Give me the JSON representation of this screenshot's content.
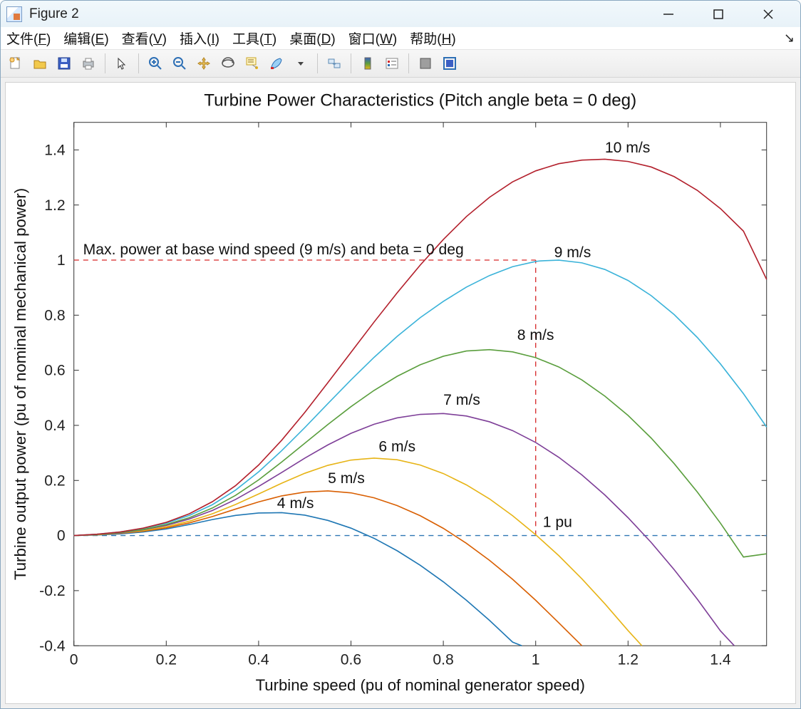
{
  "window": {
    "title": "Figure 2"
  },
  "menu": {
    "file": {
      "label": "文件",
      "key": "F"
    },
    "edit": {
      "label": "编辑",
      "key": "E"
    },
    "view": {
      "label": "查看",
      "key": "V"
    },
    "insert": {
      "label": "插入",
      "key": "I"
    },
    "tools": {
      "label": "工具",
      "key": "T"
    },
    "desktop": {
      "label": "桌面",
      "key": "D"
    },
    "window": {
      "label": "窗口",
      "key": "W"
    },
    "help": {
      "label": "帮助",
      "key": "H"
    }
  },
  "toolbar_icons": [
    "new-figure-icon",
    "open-icon",
    "save-icon",
    "print-icon",
    "|",
    "pointer-icon",
    "|",
    "zoom-in-icon",
    "zoom-out-icon",
    "pan-icon",
    "rotate3d-icon",
    "data-cursor-icon",
    "brush-icon",
    "dropdown-icon",
    "|",
    "link-plot-icon",
    "|",
    "colorbar-icon",
    "legend-icon",
    "|",
    "hide-plot-icon",
    "show-plot-icon"
  ],
  "chart_data": {
    "type": "line",
    "title": "Turbine Power Characteristics (Pitch angle beta = 0 deg)",
    "xlabel": "Turbine speed (pu of nominal generator speed)",
    "ylabel": "Turbine output power (pu of nominal mechanical power)",
    "xlim": [
      0,
      1.5
    ],
    "ylim": [
      -0.4,
      1.5
    ],
    "xticks": [
      0,
      0.2,
      0.4,
      0.6,
      0.8,
      1,
      1.2,
      1.4
    ],
    "yticks": [
      -0.4,
      -0.2,
      0,
      0.2,
      0.4,
      0.6,
      0.8,
      1,
      1.2,
      1.4
    ],
    "annotations": {
      "max_power": "Max. power at base wind speed (9 m/s) and beta = 0 deg",
      "one_pu": "1 pu"
    },
    "ref_lines": {
      "h_zero": {
        "y": 0,
        "color": "#2f77b4",
        "dash": true
      },
      "h_one": {
        "y": 1,
        "x_to": 1.0,
        "color": "#d62728",
        "dash": true
      },
      "v_one": {
        "x": 1.0,
        "y_from": 0,
        "y_to": 1.0,
        "color": "#d62728",
        "dash": true
      }
    },
    "series": [
      {
        "name": "4 m/s",
        "color": "#1f77b4",
        "label_at": [
          0.44,
          0.1
        ],
        "points": [
          [
            0.0,
            0.0
          ],
          [
            0.05,
            0.002
          ],
          [
            0.1,
            0.006
          ],
          [
            0.15,
            0.013
          ],
          [
            0.2,
            0.024
          ],
          [
            0.25,
            0.04
          ],
          [
            0.3,
            0.058
          ],
          [
            0.35,
            0.073
          ],
          [
            0.4,
            0.082
          ],
          [
            0.45,
            0.083
          ],
          [
            0.5,
            0.074
          ],
          [
            0.55,
            0.055
          ],
          [
            0.6,
            0.027
          ],
          [
            0.65,
            -0.01
          ],
          [
            0.7,
            -0.055
          ],
          [
            0.75,
            -0.108
          ],
          [
            0.8,
            -0.168
          ],
          [
            0.85,
            -0.235
          ],
          [
            0.9,
            -0.308
          ],
          [
            0.95,
            -0.387
          ],
          [
            0.97,
            -0.4
          ]
        ]
      },
      {
        "name": "5 m/s",
        "color": "#d95f02",
        "label_at": [
          0.55,
          0.19
        ],
        "points": [
          [
            0.0,
            0.0
          ],
          [
            0.05,
            0.003
          ],
          [
            0.1,
            0.008
          ],
          [
            0.15,
            0.016
          ],
          [
            0.2,
            0.028
          ],
          [
            0.25,
            0.046
          ],
          [
            0.3,
            0.069
          ],
          [
            0.35,
            0.096
          ],
          [
            0.4,
            0.122
          ],
          [
            0.45,
            0.144
          ],
          [
            0.5,
            0.158
          ],
          [
            0.55,
            0.162
          ],
          [
            0.6,
            0.155
          ],
          [
            0.65,
            0.137
          ],
          [
            0.7,
            0.109
          ],
          [
            0.75,
            0.072
          ],
          [
            0.8,
            0.026
          ],
          [
            0.85,
            -0.028
          ],
          [
            0.9,
            -0.09
          ],
          [
            0.95,
            -0.159
          ],
          [
            1.0,
            -0.235
          ],
          [
            1.05,
            -0.317
          ],
          [
            1.1,
            -0.4
          ]
        ]
      },
      {
        "name": "6 m/s",
        "color": "#e7b416",
        "label_at": [
          0.66,
          0.305
        ],
        "points": [
          [
            0.0,
            0.0
          ],
          [
            0.05,
            0.003
          ],
          [
            0.1,
            0.009
          ],
          [
            0.15,
            0.018
          ],
          [
            0.2,
            0.032
          ],
          [
            0.25,
            0.052
          ],
          [
            0.3,
            0.079
          ],
          [
            0.35,
            0.113
          ],
          [
            0.4,
            0.151
          ],
          [
            0.45,
            0.19
          ],
          [
            0.5,
            0.226
          ],
          [
            0.55,
            0.255
          ],
          [
            0.6,
            0.274
          ],
          [
            0.65,
            0.281
          ],
          [
            0.7,
            0.275
          ],
          [
            0.75,
            0.256
          ],
          [
            0.8,
            0.225
          ],
          [
            0.85,
            0.184
          ],
          [
            0.9,
            0.133
          ],
          [
            0.95,
            0.072
          ],
          [
            1.0,
            0.003
          ],
          [
            1.05,
            -0.073
          ],
          [
            1.1,
            -0.157
          ],
          [
            1.15,
            -0.248
          ],
          [
            1.2,
            -0.345
          ],
          [
            1.23,
            -0.4
          ]
        ]
      },
      {
        "name": "7 m/s",
        "color": "#7e3f98",
        "label_at": [
          0.8,
          0.475
        ],
        "points": [
          [
            0.0,
            0.0
          ],
          [
            0.05,
            0.004
          ],
          [
            0.1,
            0.01
          ],
          [
            0.15,
            0.021
          ],
          [
            0.2,
            0.037
          ],
          [
            0.25,
            0.06
          ],
          [
            0.3,
            0.091
          ],
          [
            0.35,
            0.131
          ],
          [
            0.4,
            0.178
          ],
          [
            0.45,
            0.229
          ],
          [
            0.5,
            0.281
          ],
          [
            0.55,
            0.329
          ],
          [
            0.6,
            0.371
          ],
          [
            0.65,
            0.404
          ],
          [
            0.7,
            0.427
          ],
          [
            0.75,
            0.44
          ],
          [
            0.8,
            0.443
          ],
          [
            0.85,
            0.434
          ],
          [
            0.9,
            0.413
          ],
          [
            0.95,
            0.381
          ],
          [
            1.0,
            0.338
          ],
          [
            1.05,
            0.284
          ],
          [
            1.1,
            0.22
          ],
          [
            1.15,
            0.147
          ],
          [
            1.2,
            0.065
          ],
          [
            1.25,
            -0.025
          ],
          [
            1.3,
            -0.124
          ],
          [
            1.35,
            -0.231
          ],
          [
            1.4,
            -0.346
          ],
          [
            1.43,
            -0.4
          ]
        ]
      },
      {
        "name": "8 m/s",
        "color": "#5a9e3d",
        "label_at": [
          0.96,
          0.71
        ],
        "points": [
          [
            0.0,
            0.0
          ],
          [
            0.05,
            0.004
          ],
          [
            0.1,
            0.011
          ],
          [
            0.15,
            0.022
          ],
          [
            0.2,
            0.04
          ],
          [
            0.25,
            0.065
          ],
          [
            0.3,
            0.1
          ],
          [
            0.35,
            0.146
          ],
          [
            0.4,
            0.202
          ],
          [
            0.45,
            0.267
          ],
          [
            0.5,
            0.335
          ],
          [
            0.55,
            0.403
          ],
          [
            0.6,
            0.468
          ],
          [
            0.65,
            0.527
          ],
          [
            0.7,
            0.578
          ],
          [
            0.75,
            0.62
          ],
          [
            0.8,
            0.651
          ],
          [
            0.85,
            0.67
          ],
          [
            0.9,
            0.675
          ],
          [
            0.95,
            0.667
          ],
          [
            1.0,
            0.646
          ],
          [
            1.05,
            0.612
          ],
          [
            1.1,
            0.565
          ],
          [
            1.15,
            0.506
          ],
          [
            1.2,
            0.436
          ],
          [
            1.25,
            0.354
          ],
          [
            1.3,
            0.261
          ],
          [
            1.35,
            0.158
          ],
          [
            1.4,
            0.045
          ],
          [
            1.45,
            -0.078
          ],
          [
            1.5,
            -0.066
          ]
        ]
      },
      {
        "name": "9 m/s",
        "color": "#3bb3d9",
        "label_at": [
          1.04,
          1.01
        ],
        "points": [
          [
            0.0,
            0.0
          ],
          [
            0.05,
            0.005
          ],
          [
            0.1,
            0.013
          ],
          [
            0.15,
            0.026
          ],
          [
            0.2,
            0.045
          ],
          [
            0.25,
            0.073
          ],
          [
            0.3,
            0.112
          ],
          [
            0.35,
            0.165
          ],
          [
            0.4,
            0.231
          ],
          [
            0.45,
            0.308
          ],
          [
            0.5,
            0.392
          ],
          [
            0.55,
            0.479
          ],
          [
            0.6,
            0.565
          ],
          [
            0.65,
            0.647
          ],
          [
            0.7,
            0.723
          ],
          [
            0.75,
            0.791
          ],
          [
            0.8,
            0.85
          ],
          [
            0.85,
            0.902
          ],
          [
            0.9,
            0.944
          ],
          [
            0.95,
            0.976
          ],
          [
            1.0,
            0.995
          ],
          [
            1.01,
            0.997
          ],
          [
            1.05,
            1.0
          ],
          [
            1.1,
            0.99
          ],
          [
            1.15,
            0.966
          ],
          [
            1.2,
            0.926
          ],
          [
            1.25,
            0.871
          ],
          [
            1.3,
            0.802
          ],
          [
            1.35,
            0.719
          ],
          [
            1.4,
            0.623
          ],
          [
            1.45,
            0.515
          ],
          [
            1.5,
            0.394
          ]
        ]
      },
      {
        "name": "10 m/s",
        "color": "#b3202c",
        "label_at": [
          1.15,
          1.39
        ],
        "points": [
          [
            0.0,
            0.0
          ],
          [
            0.05,
            0.005
          ],
          [
            0.1,
            0.013
          ],
          [
            0.15,
            0.027
          ],
          [
            0.2,
            0.048
          ],
          [
            0.25,
            0.079
          ],
          [
            0.3,
            0.123
          ],
          [
            0.35,
            0.181
          ],
          [
            0.4,
            0.256
          ],
          [
            0.45,
            0.346
          ],
          [
            0.5,
            0.447
          ],
          [
            0.55,
            0.555
          ],
          [
            0.6,
            0.665
          ],
          [
            0.65,
            0.775
          ],
          [
            0.7,
            0.881
          ],
          [
            0.75,
            0.982
          ],
          [
            0.8,
            1.075
          ],
          [
            0.85,
            1.158
          ],
          [
            0.9,
            1.228
          ],
          [
            0.95,
            1.284
          ],
          [
            1.0,
            1.324
          ],
          [
            1.05,
            1.35
          ],
          [
            1.1,
            1.363
          ],
          [
            1.15,
            1.366
          ],
          [
            1.2,
            1.358
          ],
          [
            1.25,
            1.338
          ],
          [
            1.3,
            1.303
          ],
          [
            1.35,
            1.253
          ],
          [
            1.4,
            1.187
          ],
          [
            1.45,
            1.105
          ],
          [
            1.5,
            0.93
          ]
        ]
      }
    ]
  }
}
